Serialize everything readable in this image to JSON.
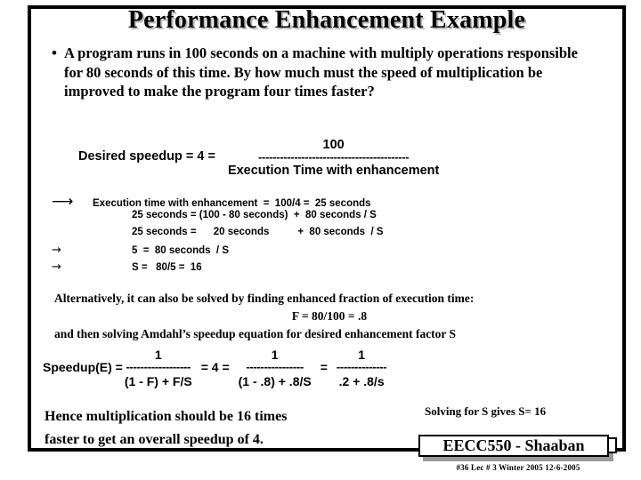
{
  "slide": {
    "title": "Performance Enhancement Example",
    "bullet_marker": "•",
    "bullet_text": "A program runs in 100 seconds on a machine with multiply operations responsible for 80 seconds of this time.    By how much must the speed of multiplication be improved to make the program four times faster?"
  },
  "desired_speedup": {
    "label": "Desired speedup =  4  =",
    "numerator": "100",
    "rule": "------------------------------------------",
    "denominator": "Execution Time with enhancement"
  },
  "derivation": {
    "arrow_large": "⟶",
    "arrow_small": "→",
    "rows": [
      {
        "arrow": "⟶",
        "text": "Execution time with enhancement  =  100/4 =  25 seconds"
      },
      {
        "arrow": "",
        "text": "25 seconds = (100 - 80 seconds)  +  80 seconds / S"
      },
      {
        "arrow": "",
        "text": "25 seconds =      20 seconds          +  80 seconds  / S"
      },
      {
        "arrow": "→",
        "text": "5  =  80 seconds  / S"
      },
      {
        "arrow": "→",
        "text": "S =   80/5 =  16"
      }
    ]
  },
  "alternative": {
    "line1": "Alternatively, it can also be solved by finding  enhanced fraction of execution time:",
    "line2": "F =  80/100 = .8",
    "line3": "and then solving Amdahl’s speedup equation for desired enhancement factor  S"
  },
  "speedup_equation": {
    "label": "Speedup(E) =",
    "rule_long": "------------------",
    "rule_mid": "----------------",
    "rule_short": "--------------",
    "frac1_num": "1",
    "frac1_den": "(1 - F)  + F/S",
    "op1": "= 4  =",
    "frac2_num": "1",
    "frac2_den": "(1 - .8) + .8/S",
    "op2": "=",
    "frac3_num": "1",
    "frac3_den": ".2  +  .8/s"
  },
  "conclusion": {
    "line1": "Hence multiplication should be 16 times",
    "line2": "faster to get an overall speedup of 4."
  },
  "solving_note": "Solving for S gives S= 16",
  "footer": {
    "badge": "EECC550 - Shaaban",
    "meta": "#36   Lec # 3   Winter 2005   12-6-2005"
  },
  "colors": {
    "background": "#ffffff",
    "ink": "#000000",
    "title_shadow": "#b9b9b9",
    "badge_shadow": "#9a9a9a"
  }
}
